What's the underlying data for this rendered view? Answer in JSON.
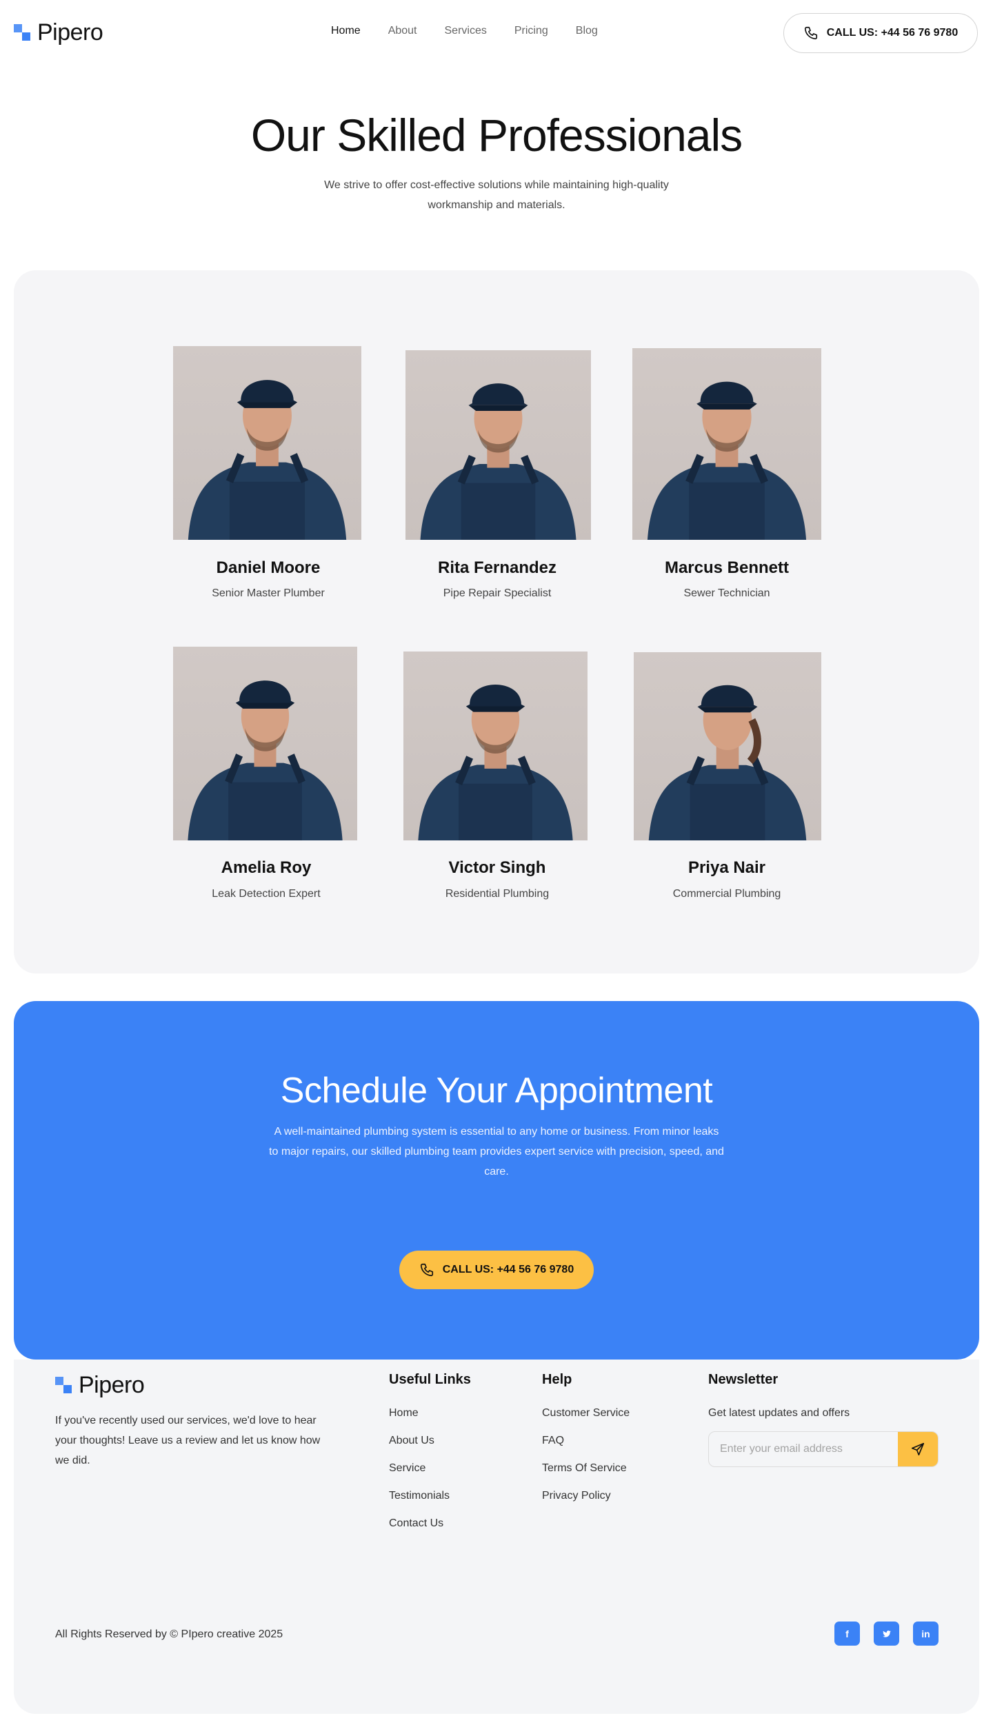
{
  "brand": {
    "name": "Pipero",
    "accent": "#3b82f6",
    "cta_yellow": "#fcc044"
  },
  "nav": {
    "items": [
      {
        "label": "Home"
      },
      {
        "label": "About"
      },
      {
        "label": "Services"
      },
      {
        "label": "Pricing"
      },
      {
        "label": "Blog"
      }
    ],
    "call_label": "CALL US: +44 56 76 9780"
  },
  "hero": {
    "title": "Our Skilled Professionals",
    "subtitle": "We strive to offer cost-effective solutions while maintaining high-quality workmanship and materials."
  },
  "team": [
    {
      "name": "Daniel Moore",
      "role": "Senior Master Plumber"
    },
    {
      "name": "Rita Fernandez",
      "role": "Pipe Repair Specialist"
    },
    {
      "name": "Marcus Bennett",
      "role": "Sewer Technician"
    },
    {
      "name": "Amelia Roy",
      "role": "Leak Detection Expert"
    },
    {
      "name": "Victor Singh",
      "role": "Residential Plumbing"
    },
    {
      "name": "Priya Nair",
      "role": "Commercial Plumbing"
    }
  ],
  "cta": {
    "title": "Schedule Your Appointment",
    "text": "A well-maintained plumbing system is essential to any home or business. From minor leaks to major repairs, our skilled plumbing team provides expert service with precision, speed, and care.",
    "button_label": "CALL US: +44 56 76 9780"
  },
  "footer": {
    "description": "If you've recently used our services, we'd love to hear your thoughts! Leave us a review and let us know how we did.",
    "useful_links": {
      "title": "Useful Links",
      "items": [
        "Home",
        "About Us",
        "Service",
        "Testimonials",
        "Contact Us"
      ]
    },
    "help": {
      "title": "Help",
      "items": [
        "Customer Service",
        "FAQ",
        "Terms Of Service",
        "Privacy Policy"
      ]
    },
    "newsletter": {
      "title": "Newsletter",
      "text": "Get latest updates and offers",
      "placeholder": "Enter your email address"
    },
    "copyright": "All Rights Reserved by © PIpero creative 2025",
    "socials": [
      {
        "icon": "facebook-icon",
        "glyph": "f"
      },
      {
        "icon": "twitter-icon",
        "glyph": "t"
      },
      {
        "icon": "linkedin-icon",
        "glyph": "in"
      }
    ]
  }
}
